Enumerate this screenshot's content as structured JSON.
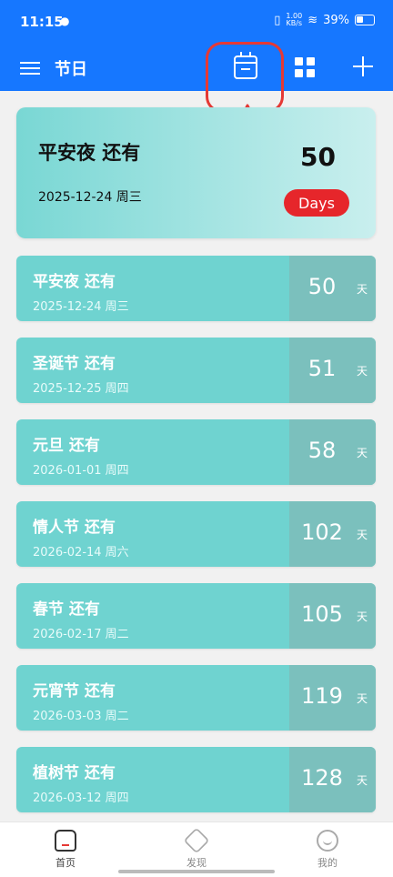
{
  "status": {
    "time": "11:15",
    "speed_top": "1.00",
    "speed_bottom": "KB/s",
    "battery": "39%"
  },
  "appbar": {
    "title": "节日"
  },
  "hero": {
    "name": "平安夜 还有",
    "date": "2025-12-24 周三",
    "count": "50",
    "unit": "Days"
  },
  "events": [
    {
      "name": "平安夜 还有",
      "date": "2025-12-24 周三",
      "count": "50",
      "unit": "天"
    },
    {
      "name": "圣诞节 还有",
      "date": "2025-12-25 周四",
      "count": "51",
      "unit": "天"
    },
    {
      "name": "元旦 还有",
      "date": "2026-01-01 周四",
      "count": "58",
      "unit": "天"
    },
    {
      "name": "情人节 还有",
      "date": "2026-02-14 周六",
      "count": "102",
      "unit": "天"
    },
    {
      "name": "春节 还有",
      "date": "2026-02-17 周二",
      "count": "105",
      "unit": "天"
    },
    {
      "name": "元宵节 还有",
      "date": "2026-03-03 周二",
      "count": "119",
      "unit": "天"
    },
    {
      "name": "植树节 还有",
      "date": "2026-03-12 周四",
      "count": "128",
      "unit": "天"
    }
  ],
  "tabs": {
    "home": "首页",
    "discover": "发现",
    "me": "我的"
  },
  "colors": {
    "accent": "#1677ff",
    "row": "#6fd3d0",
    "badge": "#e6262b",
    "annotation": "#e53935"
  }
}
